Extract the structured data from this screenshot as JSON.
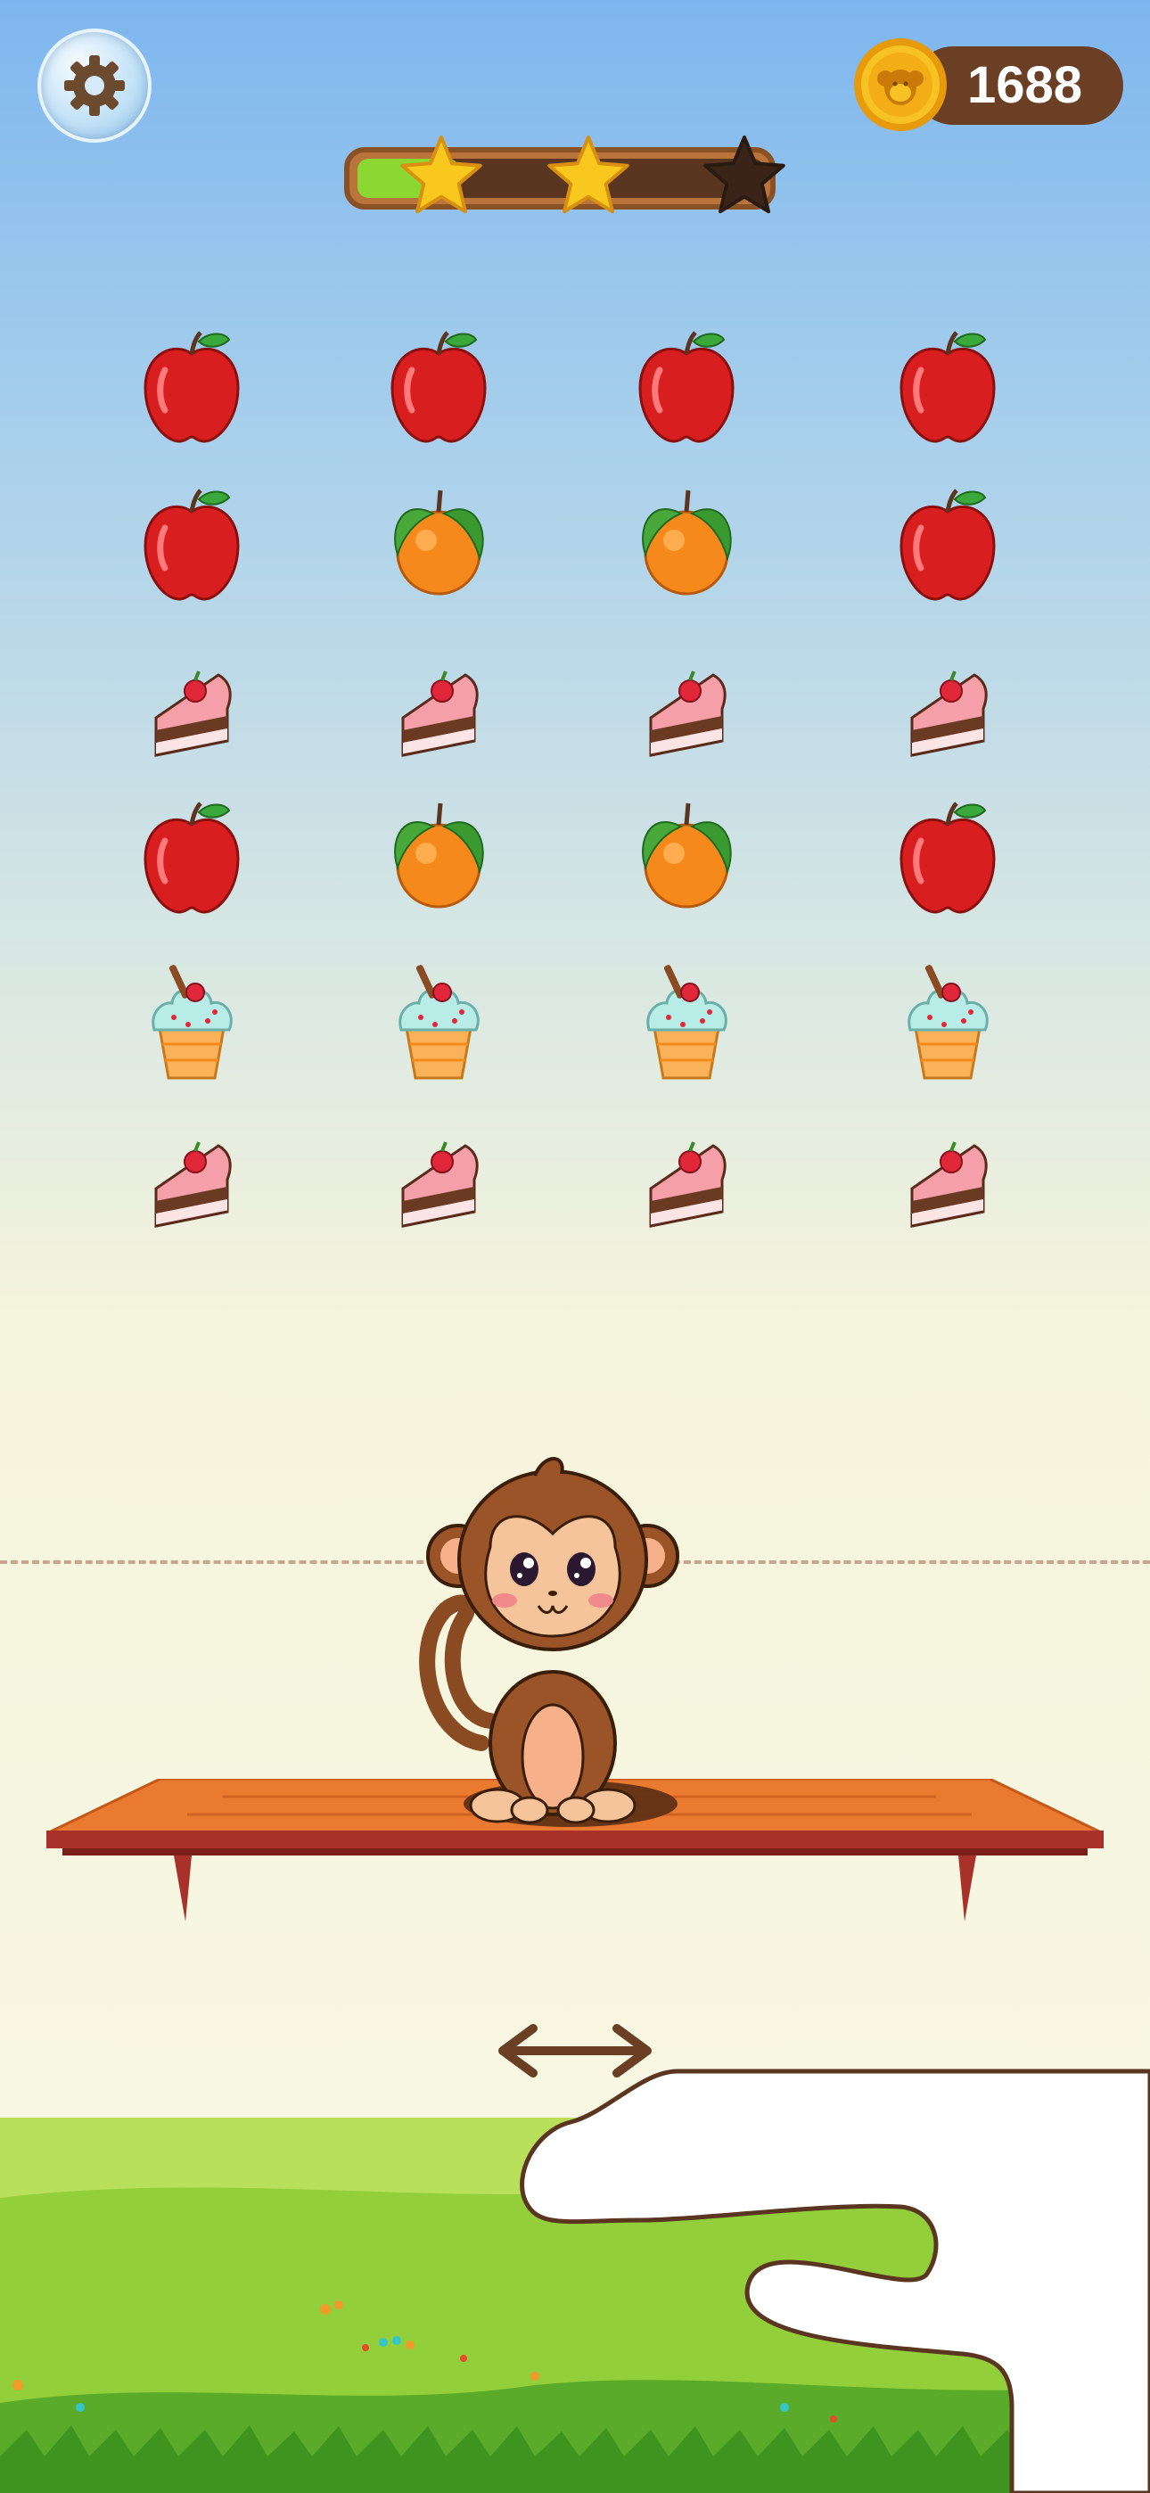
{
  "hud": {
    "coins": "1688",
    "progress": {
      "fraction": 0.25,
      "stars_total": 3,
      "stars_earned": 2
    },
    "settings_icon": "gear-icon",
    "coin_icon": "monkey-coin-icon"
  },
  "board": {
    "columns": 4,
    "rows": [
      [
        "apple",
        "apple",
        "apple",
        "apple"
      ],
      [
        "apple",
        "orange",
        "orange",
        "apple"
      ],
      [
        "cake",
        "cake",
        "cake",
        "cake"
      ],
      [
        "apple",
        "orange",
        "orange",
        "apple"
      ],
      [
        "ice-cream",
        "ice-cream",
        "ice-cream",
        "ice-cream"
      ],
      [
        "cake",
        "cake",
        "cake",
        "cake"
      ]
    ]
  },
  "player": {
    "character": "monkey",
    "platform": "wooden-shelf"
  },
  "hint": {
    "icon": "left-right-arrow-icon",
    "gesture": "hand-pointer"
  },
  "colors": {
    "progress_fill": "#8bd832",
    "progress_track": "#5a3520",
    "coin": "#f5b81c",
    "shelf": "#e8772c"
  }
}
